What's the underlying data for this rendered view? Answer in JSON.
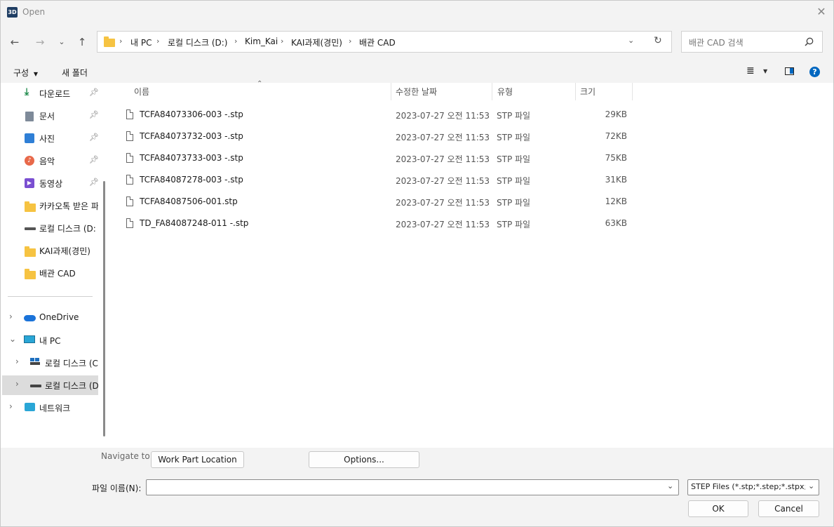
{
  "window": {
    "title": "Open",
    "app_icon_text": "3D"
  },
  "nav": {
    "breadcrumb": [
      "내 PC",
      "로컬 디스크 (D:)",
      "Kim_Kai",
      "KAI과제(경민)",
      "배관 CAD"
    ],
    "search_placeholder": "배관 CAD 검색"
  },
  "toolbar": {
    "organize": "구성",
    "new_folder": "새 폴더"
  },
  "sidebar": {
    "quick": [
      {
        "label": "다운로드",
        "icon": "download-icon"
      },
      {
        "label": "문서",
        "icon": "document-icon"
      },
      {
        "label": "사진",
        "icon": "pictures-icon"
      },
      {
        "label": "음악",
        "icon": "music-icon"
      },
      {
        "label": "동영상",
        "icon": "video-icon"
      },
      {
        "label": "카카오톡 받은 파",
        "icon": "folder-icon"
      },
      {
        "label": "로컬 디스크 (D:",
        "icon": "drive-icon"
      },
      {
        "label": "KAI과제(경민)",
        "icon": "folder-icon"
      },
      {
        "label": "배관 CAD",
        "icon": "folder-icon"
      }
    ],
    "tree": [
      {
        "label": "OneDrive",
        "icon": "cloud-icon"
      },
      {
        "label": "내 PC",
        "icon": "pc-icon"
      },
      {
        "label": "로컬 디스크 (C",
        "icon": "windows-drive-icon"
      },
      {
        "label": "로컬 디스크 (D",
        "icon": "drive-icon"
      },
      {
        "label": "네트워크",
        "icon": "network-icon"
      }
    ]
  },
  "columns": {
    "name": "이름",
    "modified": "수정한 날짜",
    "type": "유형",
    "size": "크기"
  },
  "files": [
    {
      "name": "TCFA84073306-003 -.stp",
      "modified": "2023-07-27 오전 11:53",
      "type": "STP 파일",
      "size": "29KB"
    },
    {
      "name": "TCFA84073732-003 -.stp",
      "modified": "2023-07-27 오전 11:53",
      "type": "STP 파일",
      "size": "72KB"
    },
    {
      "name": "TCFA84073733-003 -.stp",
      "modified": "2023-07-27 오전 11:53",
      "type": "STP 파일",
      "size": "75KB"
    },
    {
      "name": "TCFA84087278-003 -.stp",
      "modified": "2023-07-27 오전 11:53",
      "type": "STP 파일",
      "size": "31KB"
    },
    {
      "name": "TCFA84087506-001.stp",
      "modified": "2023-07-27 오전 11:53",
      "type": "STP 파일",
      "size": "12KB"
    },
    {
      "name": "TD_FA84087248-011 -.stp",
      "modified": "2023-07-27 오전 11:53",
      "type": "STP 파일",
      "size": "63KB"
    }
  ],
  "navigate": {
    "label": "Navigate to:",
    "work_part": "Work Part Location",
    "options": "Options..."
  },
  "footer": {
    "filename_label": "파일 이름(N):",
    "filename_value": "",
    "filter": "STEP Files (*.stp;*.step;*.stpx;*.s",
    "ok": "OK",
    "cancel": "Cancel"
  },
  "colors": {
    "accent": "#0067c0",
    "folder": "#f6c342",
    "selected": "#dcdcdc"
  }
}
